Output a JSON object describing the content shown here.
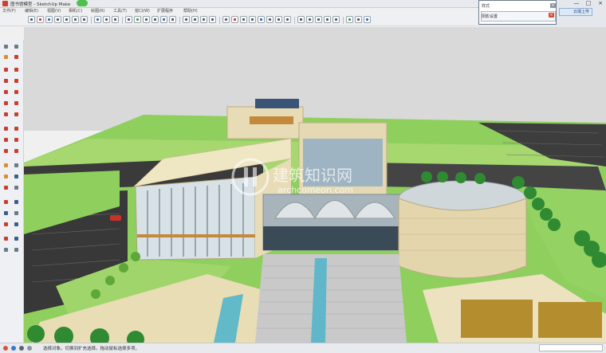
{
  "window": {
    "title": "图书馆模型 - SketchUp Make",
    "controls": [
      "—",
      "□",
      "×"
    ]
  },
  "menu": [
    "文件(F)",
    "编辑(E)",
    "视图(V)",
    "相机(C)",
    "绘图(R)",
    "工具(T)",
    "窗口(W)",
    "扩展程序",
    "帮助(H)"
  ],
  "tray": {
    "row1": "样式",
    "row2": "阴影设置"
  },
  "upload": {
    "label": "云端上传"
  },
  "watermark": {
    "cn": "建筑知识网",
    "en": "archcomeon.com"
  },
  "status": {
    "message": "选择对象。切换到扩充选择。拖动鼠标选择多项。",
    "vcb_label": ""
  },
  "colors": {
    "sky": "#d9d9d9",
    "grass": "#8fcf5e",
    "road": "#3c3c3c",
    "facade": "#e8dcb6"
  }
}
